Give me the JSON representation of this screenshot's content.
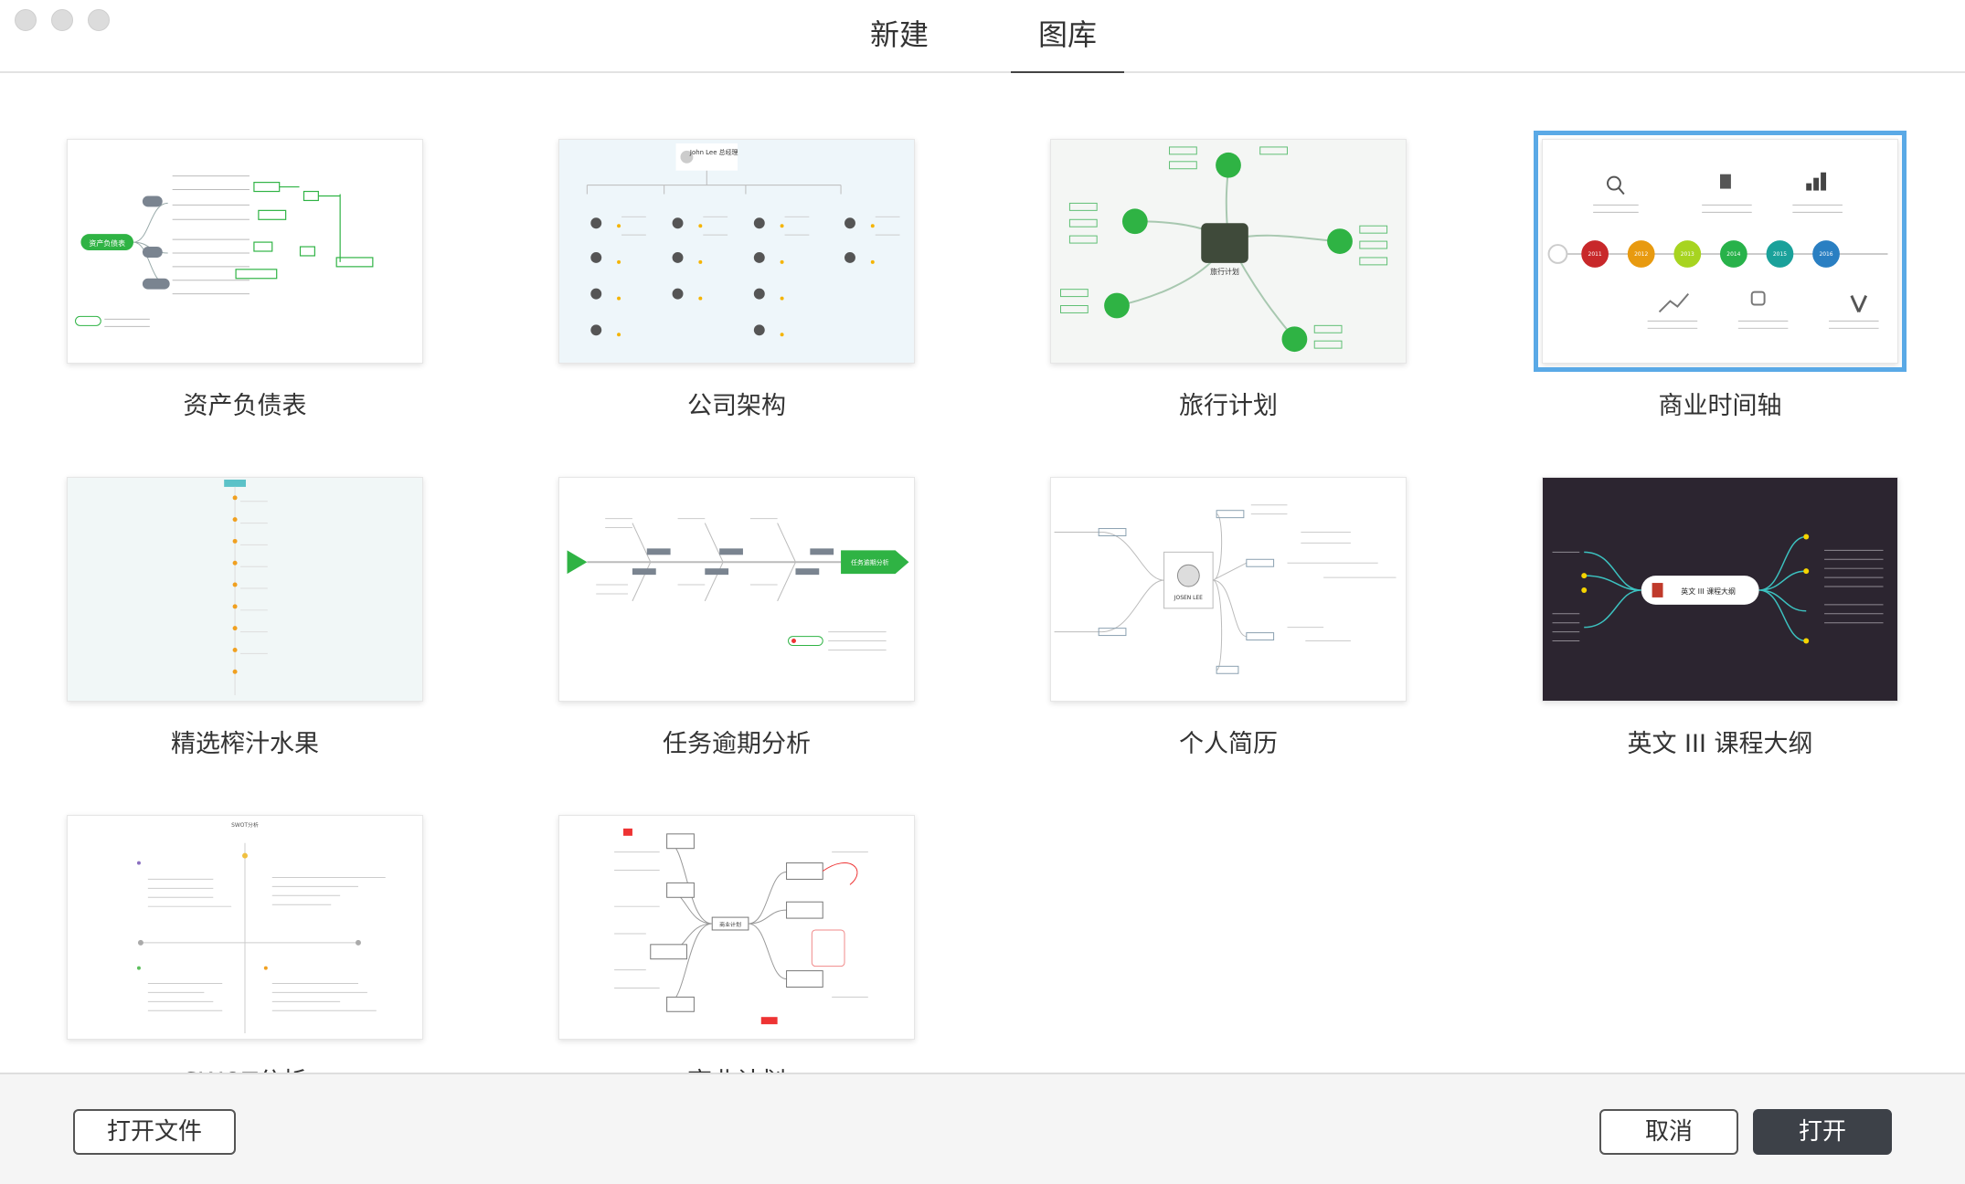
{
  "tabs": [
    {
      "label": "新建",
      "active": false
    },
    {
      "label": "图库",
      "active": true
    }
  ],
  "templates": [
    {
      "label": "资产负债表",
      "thumb_text": "资产负债表"
    },
    {
      "label": "公司架构",
      "thumb_text": "John Lee 总经理"
    },
    {
      "label": "旅行计划",
      "thumb_text": "旅行计划"
    },
    {
      "label": "商业时间轴",
      "thumb_text": "",
      "years": [
        "2011",
        "2012",
        "2013",
        "2014",
        "2015",
        "2016"
      ],
      "selected": true
    },
    {
      "label": "精选榨汁水果",
      "thumb_text": ""
    },
    {
      "label": "任务逾期分析",
      "thumb_text": "任务逾期分析"
    },
    {
      "label": "个人简历",
      "thumb_text": "JOSEN LEE"
    },
    {
      "label": "英文 III 课程大纲",
      "thumb_text": "英文 III 课程大纲"
    },
    {
      "label": "SWOT分析",
      "thumb_text": "SWOT分析"
    },
    {
      "label": "商业计划",
      "thumb_text": "商业计划"
    }
  ],
  "footer": {
    "open_file_label": "打开文件",
    "cancel_label": "取消",
    "open_label": "打开"
  },
  "colors": {
    "accent_selection": "#5aa9e6",
    "primary_button": "#3d4148",
    "mindmap_green": "#2fb344"
  }
}
